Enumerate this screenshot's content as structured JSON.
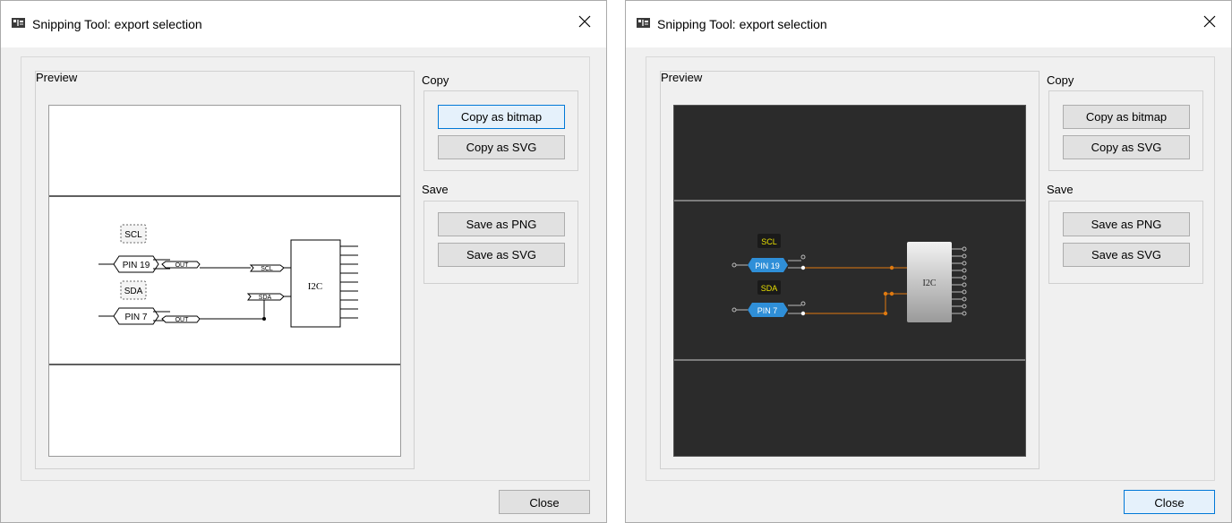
{
  "dialogs": [
    {
      "theme": "light",
      "title": "Snipping Tool: export selection",
      "preview_label": "Preview",
      "copy_label": "Copy",
      "save_label": "Save",
      "buttons": {
        "copy_bitmap": "Copy as bitmap",
        "copy_svg": "Copy as SVG",
        "save_png": "Save as PNG",
        "save_svg": "Save as SVG",
        "close": "Close"
      },
      "diagram": {
        "pin_top": "PIN 19",
        "pin_bottom": "PIN 7",
        "tag_top": "SCL",
        "tag_bottom": "SDA",
        "out_label": "OUT",
        "port_scl": "SCL",
        "port_sda": "SDA",
        "block_label": "I2C"
      }
    },
    {
      "theme": "dark",
      "title": "Snipping Tool: export selection",
      "preview_label": "Preview",
      "copy_label": "Copy",
      "save_label": "Save",
      "buttons": {
        "copy_bitmap": "Copy as bitmap",
        "copy_svg": "Copy as SVG",
        "save_png": "Save as PNG",
        "save_svg": "Save as SVG",
        "close": "Close"
      },
      "diagram": {
        "pin_top": "PIN 19",
        "pin_bottom": "PIN 7",
        "tag_top": "SCL",
        "tag_bottom": "SDA",
        "block_label": "I2C"
      }
    }
  ],
  "colors": {
    "accent": "#0078d7",
    "dark_canvas": "#2b2b2b",
    "wire_orange": "#e07a10",
    "pin_blue": "#2f8fd8",
    "tag_yellow": "#e8e000"
  },
  "icons": {
    "app": "snipping-tool-app-icon",
    "close": "close-icon"
  }
}
